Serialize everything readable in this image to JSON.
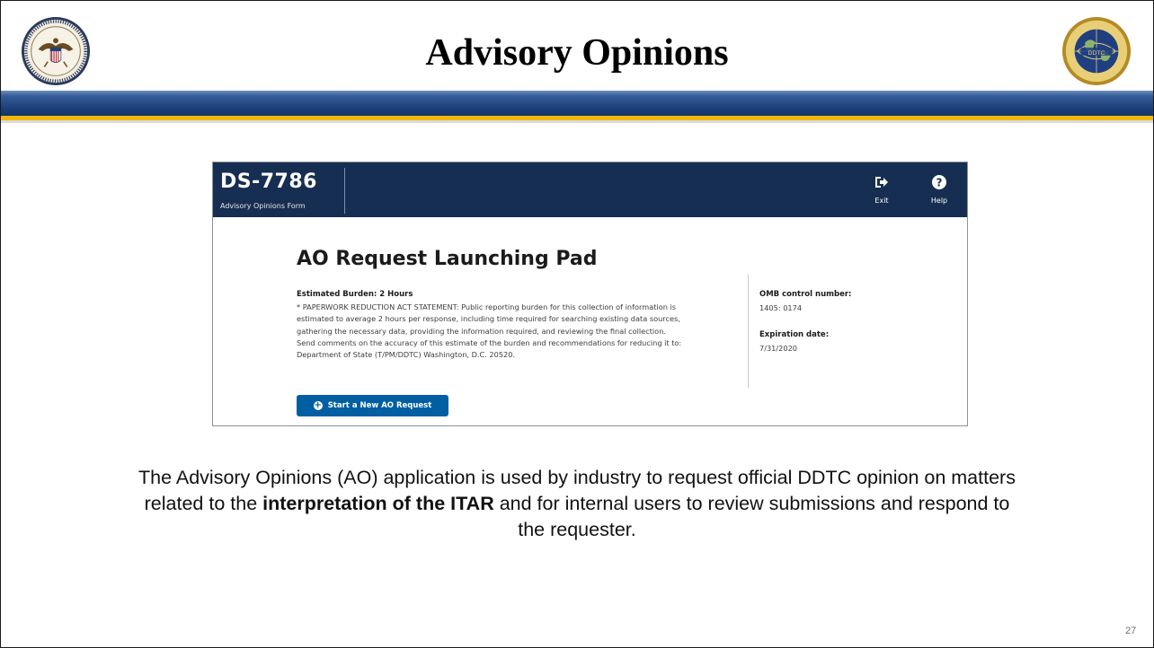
{
  "slide": {
    "title": "Advisory Opinions",
    "page_number": "27",
    "left_seal_icon": "us-department-of-state-seal",
    "right_seal_icon": "ddtc-seal",
    "right_seal_text": "DDTC",
    "colors": {
      "band": "#1c3f78",
      "gold": "#f2b705"
    }
  },
  "app": {
    "form_code": "DS-7786",
    "form_subtitle": "Advisory Opinions Form",
    "header_actions": [
      {
        "label": "Exit",
        "icon": "exit-icon"
      },
      {
        "label": "Help",
        "icon": "help-icon"
      }
    ],
    "page_title": "AO Request Launching Pad",
    "burden_heading": "Estimated Burden: 2 Hours",
    "statement_lines": [
      "* PAPERWORK REDUCTION ACT STATEMENT: Public reporting burden for this collection of information is",
      "estimated to average 2 hours per response, including time required for searching existing data sources,",
      "gathering the necessary data, providing the information required, and reviewing the final collection.",
      "Send comments on the accuracy of this estimate of the burden and recommendations for reducing it to:",
      "Department of State (T/PM/DDTC) Washington, D.C. 20520."
    ],
    "omb_label": "OMB control number:",
    "omb_value": "1405: 0174",
    "expiration_label": "Expiration date:",
    "expiration_value": "7/31/2020",
    "start_button_label": "Start a New AO Request",
    "colors": {
      "header": "#162e51",
      "button": "#005ea2"
    }
  },
  "caption": {
    "part1": "The Advisory Opinions (AO) application is used by industry to request official DDTC opinion on matters related to the ",
    "bold": "interpretation of the ITAR",
    "part2": " and for internal users to review submissions and respond to the requester."
  }
}
